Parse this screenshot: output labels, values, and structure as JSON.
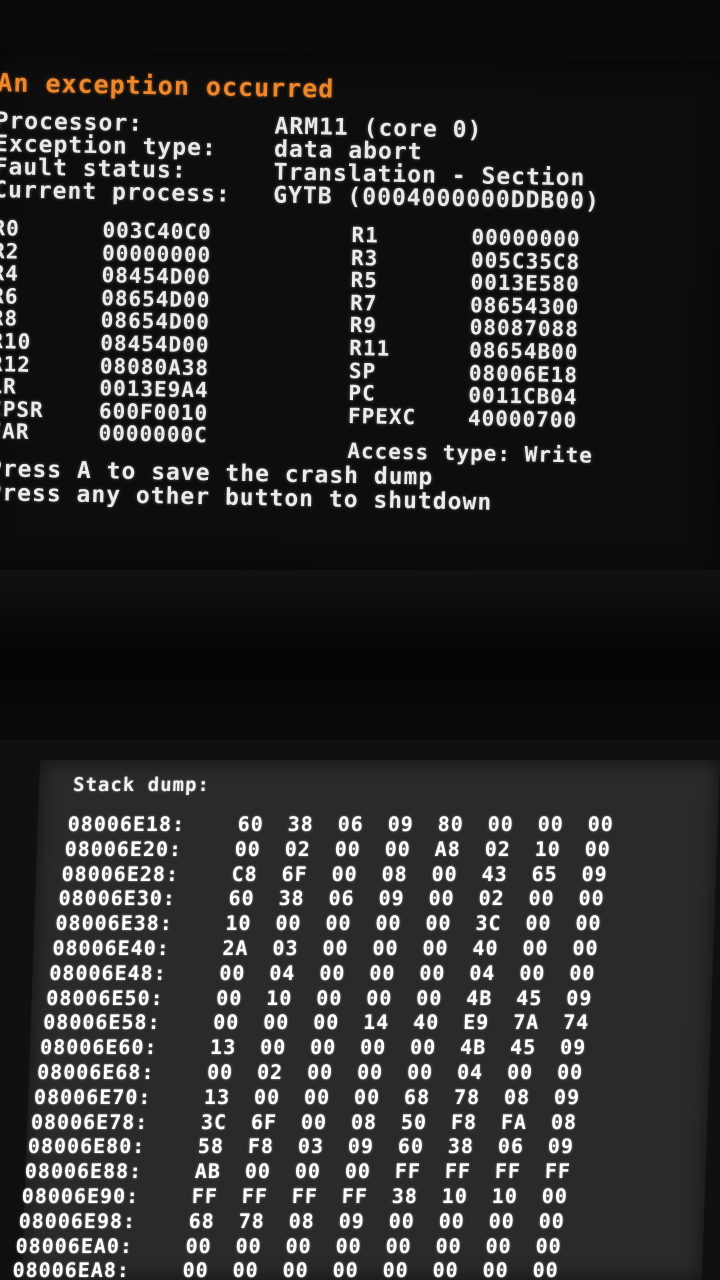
{
  "top": {
    "title": "An exception occurred",
    "info": [
      {
        "label": "Processor:",
        "value": "ARM11 (core 0)"
      },
      {
        "label": "Exception type:",
        "value": "data abort"
      },
      {
        "label": "Fault status:",
        "value": "Translation - Section"
      },
      {
        "label": "Current process:",
        "value": "GYTB (0004000000DDB00)"
      }
    ],
    "registers_left": [
      {
        "name": "R0",
        "value": "003C40C0"
      },
      {
        "name": "R2",
        "value": "00000000"
      },
      {
        "name": "R4",
        "value": "08454D00"
      },
      {
        "name": "R6",
        "value": "08654D00"
      },
      {
        "name": "R8",
        "value": "08654D00"
      },
      {
        "name": "R10",
        "value": "08454D00"
      },
      {
        "name": "R12",
        "value": "08080A38"
      },
      {
        "name": "LR",
        "value": "0013E9A4"
      },
      {
        "name": "CPSR",
        "value": "600F0010"
      },
      {
        "name": "FAR",
        "value": "0000000C"
      }
    ],
    "registers_right": [
      {
        "name": "R1",
        "value": "00000000"
      },
      {
        "name": "R3",
        "value": "005C35C8"
      },
      {
        "name": "R5",
        "value": "0013E580"
      },
      {
        "name": "R7",
        "value": "08654300"
      },
      {
        "name": "R9",
        "value": "08087088"
      },
      {
        "name": "R11",
        "value": "08654B00"
      },
      {
        "name": "SP",
        "value": "08006E18"
      },
      {
        "name": "PC",
        "value": "0011CB04"
      },
      {
        "name": "FPEXC",
        "value": "40000700"
      }
    ],
    "access_type": "Access type: Write",
    "prompts": [
      "Press A to save the crash dump",
      "Press any other button to shutdown"
    ]
  },
  "bottom": {
    "title": "Stack dump:",
    "rows": [
      {
        "addr": "08006E18:",
        "bytes": [
          "60",
          "38",
          "06",
          "09",
          "80",
          "00",
          "00",
          "00"
        ]
      },
      {
        "addr": "08006E20:",
        "bytes": [
          "00",
          "02",
          "00",
          "00",
          "A8",
          "02",
          "10",
          "00"
        ]
      },
      {
        "addr": "08006E28:",
        "bytes": [
          "C8",
          "6F",
          "00",
          "08",
          "00",
          "43",
          "65",
          "09"
        ]
      },
      {
        "addr": "08006E30:",
        "bytes": [
          "60",
          "38",
          "06",
          "09",
          "00",
          "02",
          "00",
          "00"
        ]
      },
      {
        "addr": "08006E38:",
        "bytes": [
          "10",
          "00",
          "00",
          "00",
          "00",
          "3C",
          "00",
          "00"
        ]
      },
      {
        "addr": "08006E40:",
        "bytes": [
          "2A",
          "03",
          "00",
          "00",
          "00",
          "40",
          "00",
          "00"
        ]
      },
      {
        "addr": "08006E48:",
        "bytes": [
          "00",
          "04",
          "00",
          "00",
          "00",
          "04",
          "00",
          "00"
        ]
      },
      {
        "addr": "08006E50:",
        "bytes": [
          "00",
          "10",
          "00",
          "00",
          "00",
          "4B",
          "45",
          "09"
        ]
      },
      {
        "addr": "08006E58:",
        "bytes": [
          "00",
          "00",
          "00",
          "14",
          "40",
          "E9",
          "7A",
          "74"
        ]
      },
      {
        "addr": "08006E60:",
        "bytes": [
          "13",
          "00",
          "00",
          "00",
          "00",
          "4B",
          "45",
          "09"
        ]
      },
      {
        "addr": "08006E68:",
        "bytes": [
          "00",
          "02",
          "00",
          "00",
          "00",
          "04",
          "00",
          "00"
        ]
      },
      {
        "addr": "08006E70:",
        "bytes": [
          "13",
          "00",
          "00",
          "00",
          "68",
          "78",
          "08",
          "09"
        ]
      },
      {
        "addr": "08006E78:",
        "bytes": [
          "3C",
          "6F",
          "00",
          "08",
          "50",
          "F8",
          "FA",
          "08"
        ]
      },
      {
        "addr": "08006E80:",
        "bytes": [
          "58",
          "F8",
          "03",
          "09",
          "60",
          "38",
          "06",
          "09"
        ]
      },
      {
        "addr": "08006E88:",
        "bytes": [
          "AB",
          "00",
          "00",
          "00",
          "FF",
          "FF",
          "FF",
          "FF"
        ]
      },
      {
        "addr": "08006E90:",
        "bytes": [
          "FF",
          "FF",
          "FF",
          "FF",
          "38",
          "10",
          "10",
          "00"
        ]
      },
      {
        "addr": "08006E98:",
        "bytes": [
          "68",
          "78",
          "08",
          "09",
          "00",
          "00",
          "00",
          "00"
        ]
      },
      {
        "addr": "08006EA0:",
        "bytes": [
          "00",
          "00",
          "00",
          "00",
          "00",
          "00",
          "00",
          "00"
        ]
      },
      {
        "addr": "08006EA8:",
        "bytes": [
          "00",
          "00",
          "00",
          "00",
          "00",
          "00",
          "00",
          "00"
        ]
      }
    ]
  }
}
